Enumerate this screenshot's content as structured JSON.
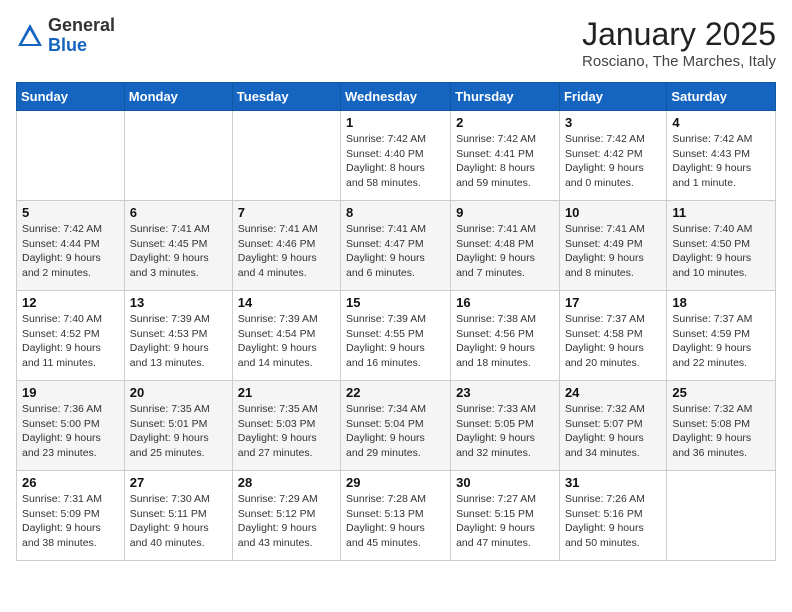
{
  "header": {
    "logo": {
      "general": "General",
      "blue": "Blue"
    },
    "title": "January 2025",
    "location": "Rosciano, The Marches, Italy"
  },
  "weekdays": [
    "Sunday",
    "Monday",
    "Tuesday",
    "Wednesday",
    "Thursday",
    "Friday",
    "Saturday"
  ],
  "weeks": [
    [
      {
        "day": "",
        "sunrise": "",
        "sunset": "",
        "daylight": ""
      },
      {
        "day": "",
        "sunrise": "",
        "sunset": "",
        "daylight": ""
      },
      {
        "day": "",
        "sunrise": "",
        "sunset": "",
        "daylight": ""
      },
      {
        "day": "1",
        "sunrise": "Sunrise: 7:42 AM",
        "sunset": "Sunset: 4:40 PM",
        "daylight": "Daylight: 8 hours and 58 minutes."
      },
      {
        "day": "2",
        "sunrise": "Sunrise: 7:42 AM",
        "sunset": "Sunset: 4:41 PM",
        "daylight": "Daylight: 8 hours and 59 minutes."
      },
      {
        "day": "3",
        "sunrise": "Sunrise: 7:42 AM",
        "sunset": "Sunset: 4:42 PM",
        "daylight": "Daylight: 9 hours and 0 minutes."
      },
      {
        "day": "4",
        "sunrise": "Sunrise: 7:42 AM",
        "sunset": "Sunset: 4:43 PM",
        "daylight": "Daylight: 9 hours and 1 minute."
      }
    ],
    [
      {
        "day": "5",
        "sunrise": "Sunrise: 7:42 AM",
        "sunset": "Sunset: 4:44 PM",
        "daylight": "Daylight: 9 hours and 2 minutes."
      },
      {
        "day": "6",
        "sunrise": "Sunrise: 7:41 AM",
        "sunset": "Sunset: 4:45 PM",
        "daylight": "Daylight: 9 hours and 3 minutes."
      },
      {
        "day": "7",
        "sunrise": "Sunrise: 7:41 AM",
        "sunset": "Sunset: 4:46 PM",
        "daylight": "Daylight: 9 hours and 4 minutes."
      },
      {
        "day": "8",
        "sunrise": "Sunrise: 7:41 AM",
        "sunset": "Sunset: 4:47 PM",
        "daylight": "Daylight: 9 hours and 6 minutes."
      },
      {
        "day": "9",
        "sunrise": "Sunrise: 7:41 AM",
        "sunset": "Sunset: 4:48 PM",
        "daylight": "Daylight: 9 hours and 7 minutes."
      },
      {
        "day": "10",
        "sunrise": "Sunrise: 7:41 AM",
        "sunset": "Sunset: 4:49 PM",
        "daylight": "Daylight: 9 hours and 8 minutes."
      },
      {
        "day": "11",
        "sunrise": "Sunrise: 7:40 AM",
        "sunset": "Sunset: 4:50 PM",
        "daylight": "Daylight: 9 hours and 10 minutes."
      }
    ],
    [
      {
        "day": "12",
        "sunrise": "Sunrise: 7:40 AM",
        "sunset": "Sunset: 4:52 PM",
        "daylight": "Daylight: 9 hours and 11 minutes."
      },
      {
        "day": "13",
        "sunrise": "Sunrise: 7:39 AM",
        "sunset": "Sunset: 4:53 PM",
        "daylight": "Daylight: 9 hours and 13 minutes."
      },
      {
        "day": "14",
        "sunrise": "Sunrise: 7:39 AM",
        "sunset": "Sunset: 4:54 PM",
        "daylight": "Daylight: 9 hours and 14 minutes."
      },
      {
        "day": "15",
        "sunrise": "Sunrise: 7:39 AM",
        "sunset": "Sunset: 4:55 PM",
        "daylight": "Daylight: 9 hours and 16 minutes."
      },
      {
        "day": "16",
        "sunrise": "Sunrise: 7:38 AM",
        "sunset": "Sunset: 4:56 PM",
        "daylight": "Daylight: 9 hours and 18 minutes."
      },
      {
        "day": "17",
        "sunrise": "Sunrise: 7:37 AM",
        "sunset": "Sunset: 4:58 PM",
        "daylight": "Daylight: 9 hours and 20 minutes."
      },
      {
        "day": "18",
        "sunrise": "Sunrise: 7:37 AM",
        "sunset": "Sunset: 4:59 PM",
        "daylight": "Daylight: 9 hours and 22 minutes."
      }
    ],
    [
      {
        "day": "19",
        "sunrise": "Sunrise: 7:36 AM",
        "sunset": "Sunset: 5:00 PM",
        "daylight": "Daylight: 9 hours and 23 minutes."
      },
      {
        "day": "20",
        "sunrise": "Sunrise: 7:35 AM",
        "sunset": "Sunset: 5:01 PM",
        "daylight": "Daylight: 9 hours and 25 minutes."
      },
      {
        "day": "21",
        "sunrise": "Sunrise: 7:35 AM",
        "sunset": "Sunset: 5:03 PM",
        "daylight": "Daylight: 9 hours and 27 minutes."
      },
      {
        "day": "22",
        "sunrise": "Sunrise: 7:34 AM",
        "sunset": "Sunset: 5:04 PM",
        "daylight": "Daylight: 9 hours and 29 minutes."
      },
      {
        "day": "23",
        "sunrise": "Sunrise: 7:33 AM",
        "sunset": "Sunset: 5:05 PM",
        "daylight": "Daylight: 9 hours and 32 minutes."
      },
      {
        "day": "24",
        "sunrise": "Sunrise: 7:32 AM",
        "sunset": "Sunset: 5:07 PM",
        "daylight": "Daylight: 9 hours and 34 minutes."
      },
      {
        "day": "25",
        "sunrise": "Sunrise: 7:32 AM",
        "sunset": "Sunset: 5:08 PM",
        "daylight": "Daylight: 9 hours and 36 minutes."
      }
    ],
    [
      {
        "day": "26",
        "sunrise": "Sunrise: 7:31 AM",
        "sunset": "Sunset: 5:09 PM",
        "daylight": "Daylight: 9 hours and 38 minutes."
      },
      {
        "day": "27",
        "sunrise": "Sunrise: 7:30 AM",
        "sunset": "Sunset: 5:11 PM",
        "daylight": "Daylight: 9 hours and 40 minutes."
      },
      {
        "day": "28",
        "sunrise": "Sunrise: 7:29 AM",
        "sunset": "Sunset: 5:12 PM",
        "daylight": "Daylight: 9 hours and 43 minutes."
      },
      {
        "day": "29",
        "sunrise": "Sunrise: 7:28 AM",
        "sunset": "Sunset: 5:13 PM",
        "daylight": "Daylight: 9 hours and 45 minutes."
      },
      {
        "day": "30",
        "sunrise": "Sunrise: 7:27 AM",
        "sunset": "Sunset: 5:15 PM",
        "daylight": "Daylight: 9 hours and 47 minutes."
      },
      {
        "day": "31",
        "sunrise": "Sunrise: 7:26 AM",
        "sunset": "Sunset: 5:16 PM",
        "daylight": "Daylight: 9 hours and 50 minutes."
      },
      {
        "day": "",
        "sunrise": "",
        "sunset": "",
        "daylight": ""
      }
    ]
  ]
}
